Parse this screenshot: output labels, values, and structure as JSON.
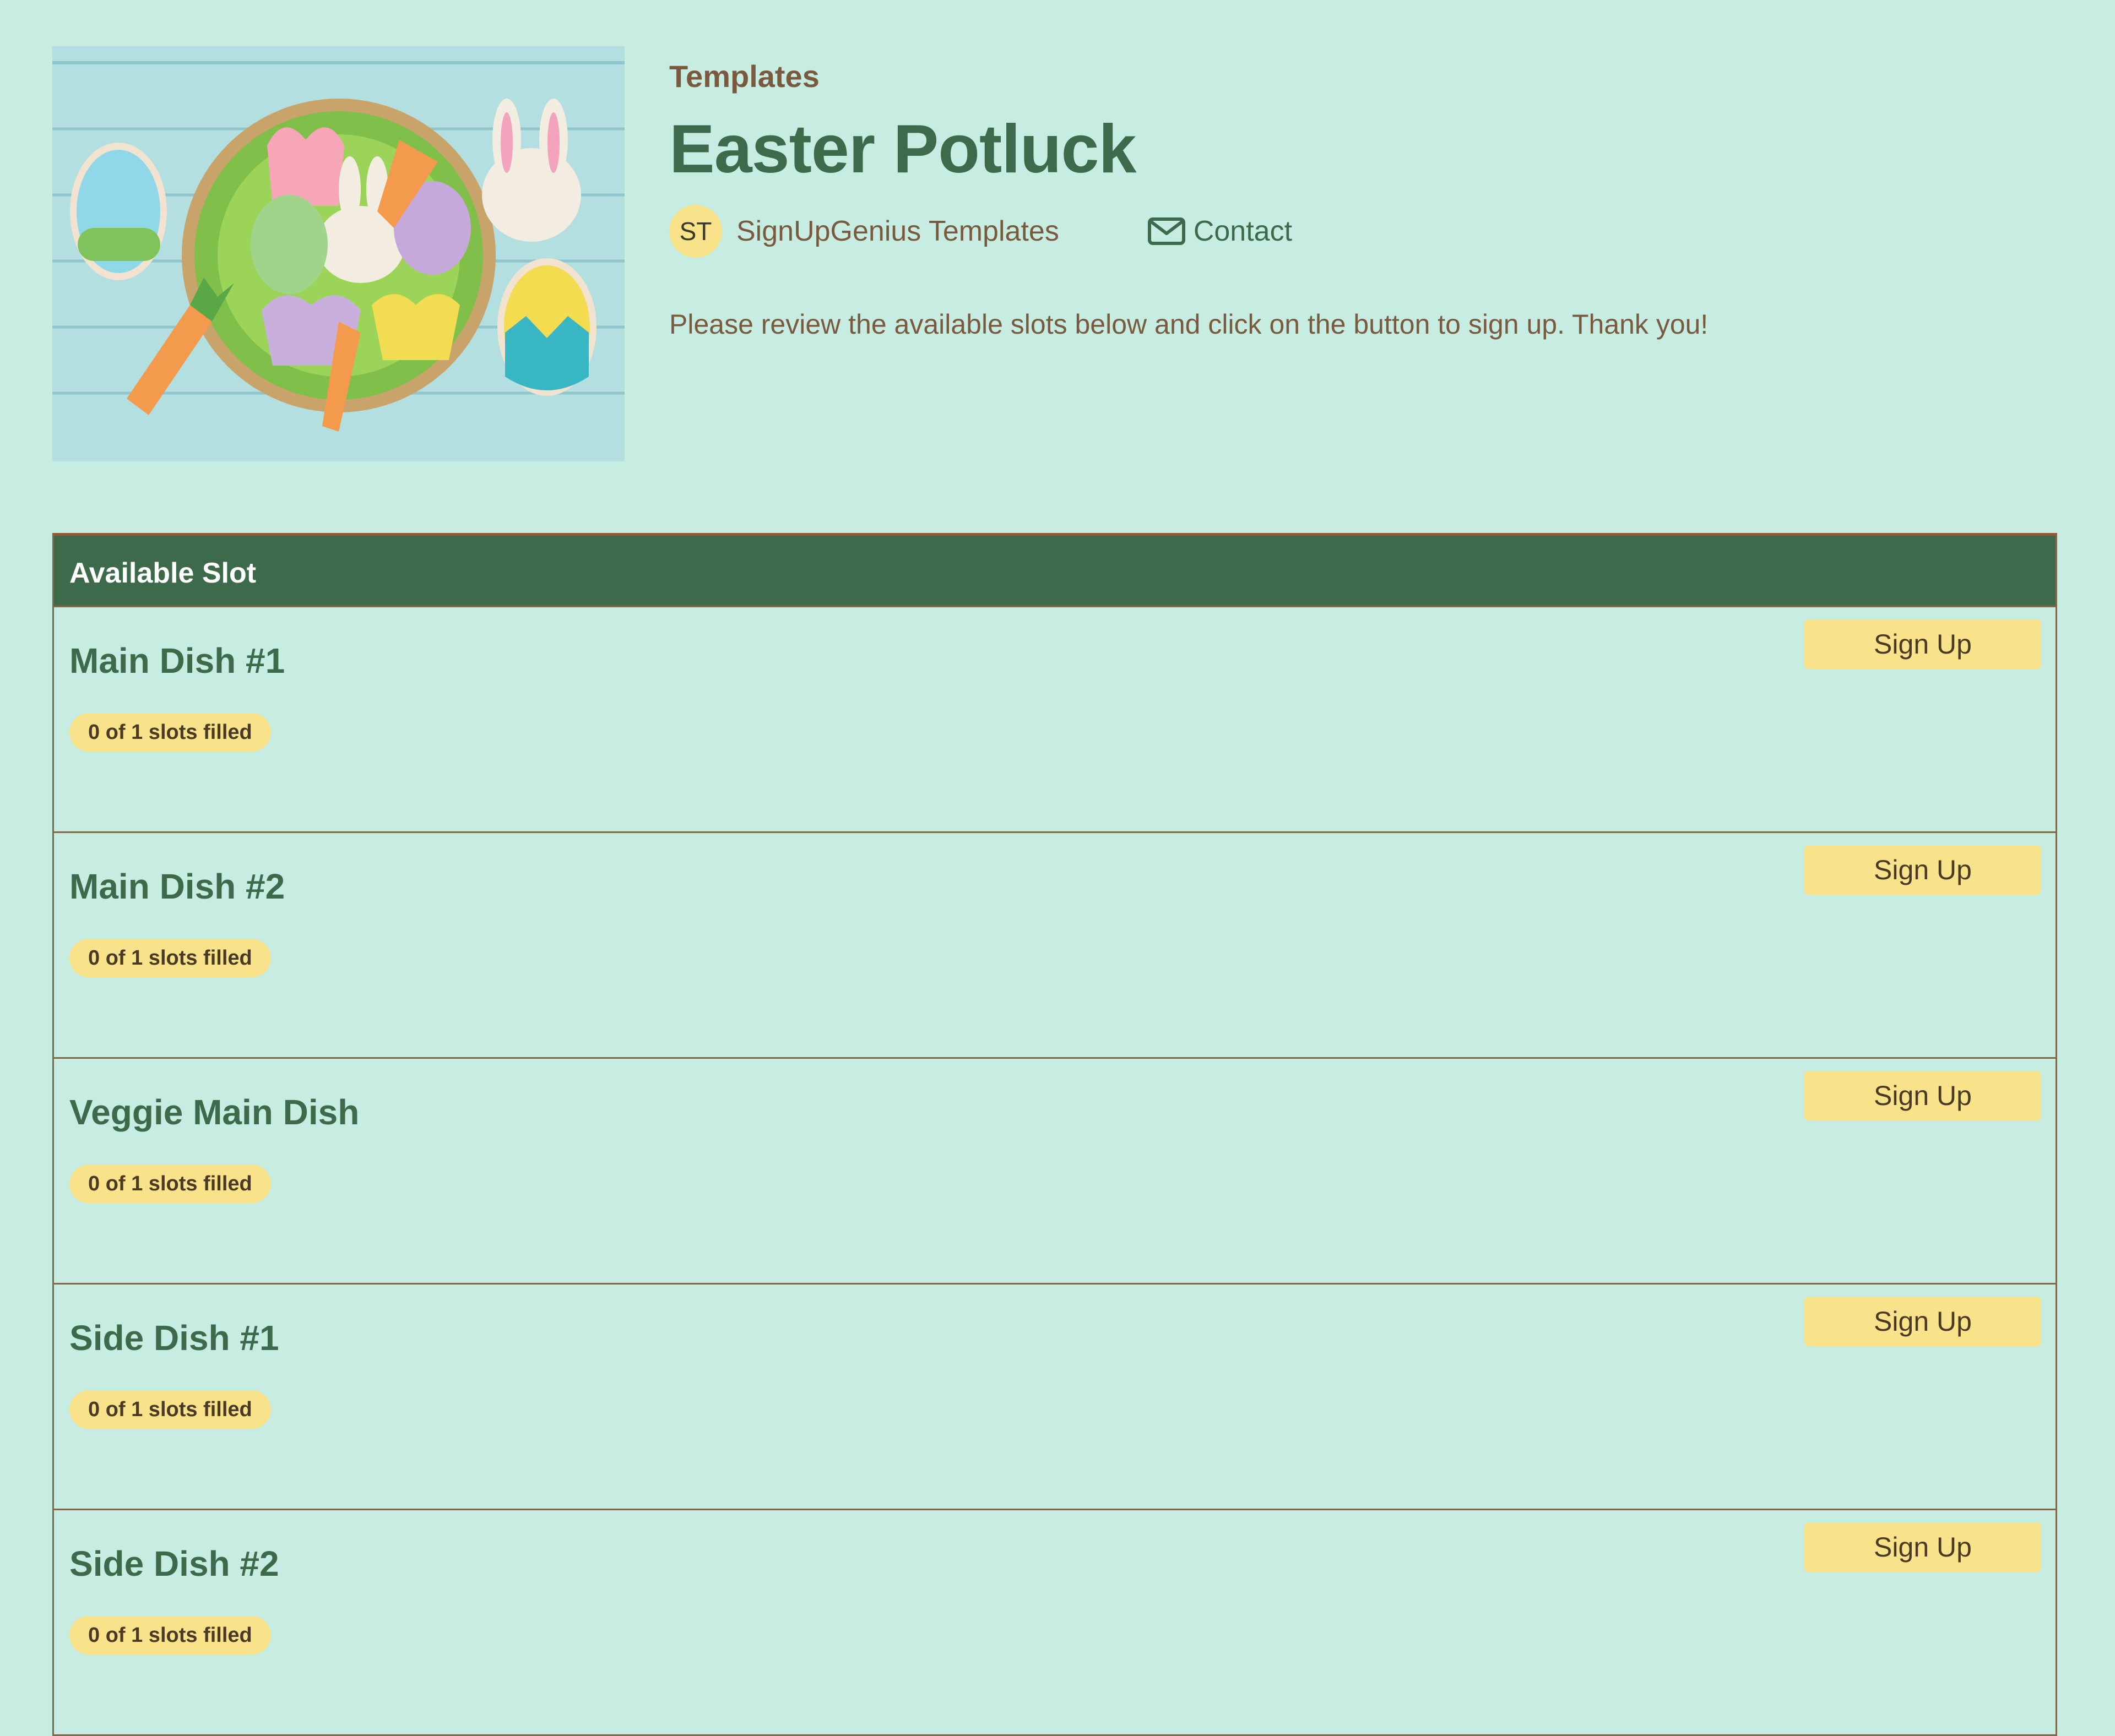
{
  "header": {
    "breadcrumb": "Templates",
    "title": "Easter Potluck",
    "owner": {
      "initials": "ST",
      "name": "SignUpGenius Templates"
    },
    "contact_label": "Contact",
    "contact_icon": "envelope-icon",
    "description": "Please review the available slots below and click on the button to sign up. Thank you!"
  },
  "table": {
    "header_label": "Available Slot",
    "slots": [
      {
        "name": "Main Dish #1",
        "filled": "0 of 1 slots filled",
        "button": "Sign Up"
      },
      {
        "name": "Main Dish #2",
        "filled": "0 of 1 slots filled",
        "button": "Sign Up"
      },
      {
        "name": "Veggie Main Dish",
        "filled": "0 of 1 slots filled",
        "button": "Sign Up"
      },
      {
        "name": "Side Dish #1",
        "filled": "0 of 1 slots filled",
        "button": "Sign Up"
      },
      {
        "name": "Side Dish #2",
        "filled": "0 of 1 slots filled",
        "button": "Sign Up"
      }
    ]
  },
  "colors": {
    "background": "#c7ece2",
    "primary_green": "#3c6a4b",
    "accent_yellow": "#f8e28a",
    "text_brown": "#7a5a3e"
  }
}
